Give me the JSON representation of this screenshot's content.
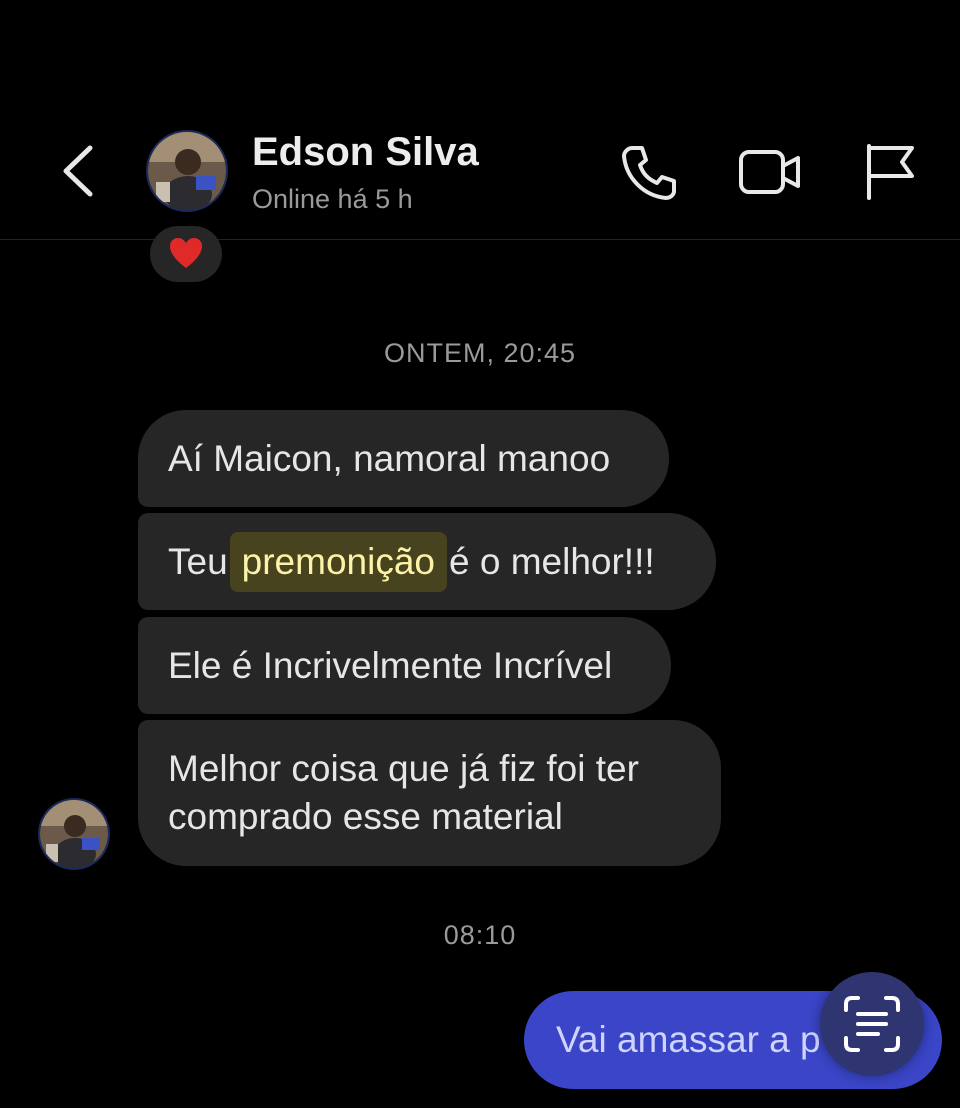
{
  "header": {
    "contact_name": "Edson Silva",
    "status": "Online há 5 h",
    "icons": [
      "back-chevron-icon",
      "phone-icon",
      "video-camera-icon",
      "flag-icon"
    ]
  },
  "reaction": {
    "emoji": "heart",
    "color": "#e02a2a"
  },
  "conversation": {
    "timestamp_1": "ONTEM, 20:45",
    "messages": [
      {
        "text": "Aí Maicon, namoral manoo"
      },
      {
        "before": "Teu",
        "highlight": "premonição",
        "after": "é o melhor!!!"
      },
      {
        "text": "Ele é Incrivelmente Incrível"
      },
      {
        "text": "Melhor coisa que já fiz foi ter comprado esse material"
      }
    ],
    "timestamp_2": "08:10",
    "outgoing": {
      "text": "Vai amassar a p"
    }
  },
  "colors": {
    "background": "#000000",
    "incoming_bubble": "#262626",
    "outgoing_bubble": "#3a45c8",
    "highlight_bg": "#48431f",
    "highlight_text": "#fdf3a8",
    "muted_text": "#9a9a9a"
  },
  "scan_button": {
    "icon": "text-scan-icon"
  }
}
